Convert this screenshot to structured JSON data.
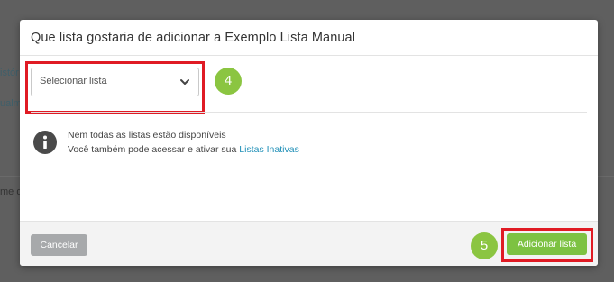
{
  "background": {
    "fragments": [
      "istór",
      "ualm",
      "me da"
    ]
  },
  "modal": {
    "title": "Que lista gostaria de adicionar a Exemplo Lista Manual",
    "select": {
      "value": "Selecionar lista",
      "icon": "chevron-down-icon"
    },
    "step_badges": {
      "select_step": "4",
      "add_step": "5"
    },
    "info": {
      "icon": "info-icon",
      "line1": "Nem todas as listas estão disponíveis",
      "line2_prefix": "Você também pode acessar e ativar sua",
      "line2_link": "Listas Inativas"
    },
    "footer": {
      "cancel_label": "Cancelar",
      "add_label": "Adicionar lista"
    }
  },
  "colors": {
    "accent_green": "#7dc242",
    "badge_green": "#8bc541",
    "highlight_red": "#e01b24",
    "link_blue": "#1f8fb7",
    "cancel_gray": "#a7a9ab"
  }
}
